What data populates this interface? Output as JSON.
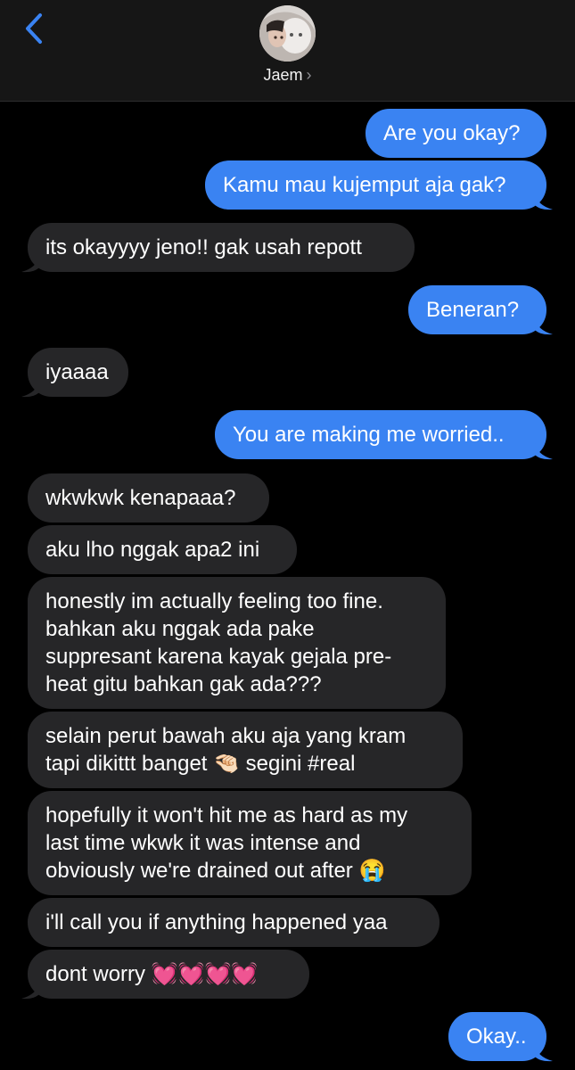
{
  "header": {
    "contact_name": "Jaem",
    "back_icon": "chevron-left-icon",
    "accent": "#3a83f2"
  },
  "messages": [
    {
      "from": "me",
      "text": "Are you okay?"
    },
    {
      "from": "me",
      "text": "Kamu mau kujemput aja gak?"
    },
    {
      "from": "them",
      "text": "its okayyyy jeno!! gak usah repott"
    },
    {
      "from": "me",
      "text": "Beneran?"
    },
    {
      "from": "them",
      "text": "iyaaaa"
    },
    {
      "from": "me",
      "text": "You are making me worried.."
    },
    {
      "from": "them",
      "text": "wkwkwk kenapaaa?"
    },
    {
      "from": "them",
      "text": "aku lho nggak apa2 ini"
    },
    {
      "from": "them",
      "lines": [
        "honestly im actually feeling too fine.",
        "bahkan aku nggak ada pake",
        "suppresant karena kayak gejala pre-",
        "heat gitu bahkan gak ada???"
      ]
    },
    {
      "from": "them",
      "lines": [
        "selain perut bawah aku aja yang kram",
        "tapi dikittt banget 🤏🏻 segini #real"
      ]
    },
    {
      "from": "them",
      "lines": [
        "hopefully it won't hit me as hard as my",
        "last time wkwk it was intense and",
        "obviously we're drained out after 😭"
      ]
    },
    {
      "from": "them",
      "text": "i'll call you if anything happened yaa"
    },
    {
      "from": "them",
      "text": "dont worry 💓💓💓💓"
    },
    {
      "from": "me",
      "text": "Okay.."
    }
  ]
}
